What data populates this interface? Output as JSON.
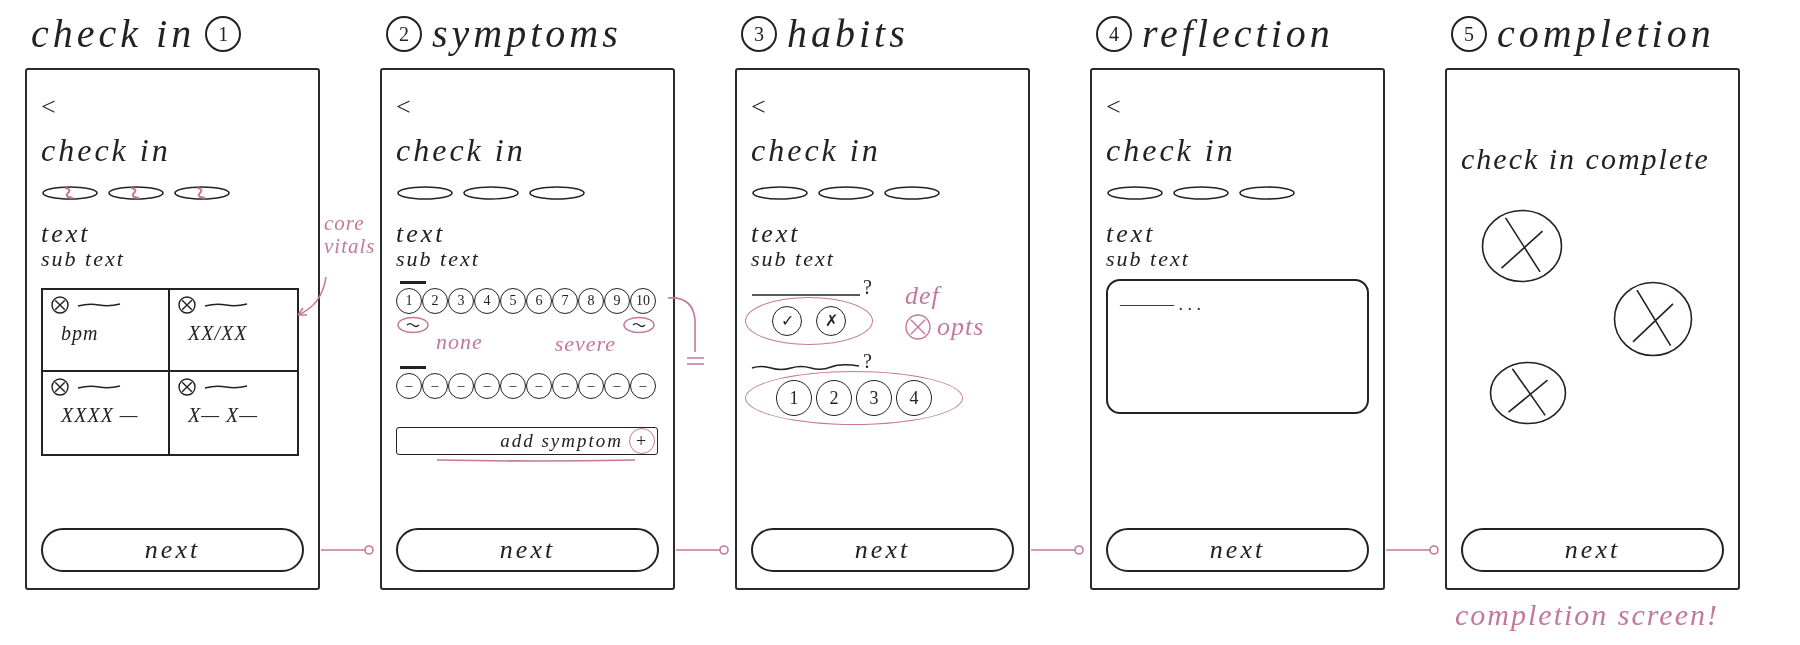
{
  "screens": [
    {
      "kind": "vitals",
      "step": "1",
      "step_after": true,
      "heading": "check in",
      "back": "<",
      "title": "check in",
      "pills": [
        {
          "marked": true
        },
        {
          "marked": true
        },
        {
          "marked": true
        }
      ],
      "text": "text",
      "subtext": "sub text",
      "vitals": [
        {
          "value": "bpm"
        },
        {
          "value": "XX/XX"
        },
        {
          "value": "XXXX —"
        },
        {
          "value": "X— X—"
        }
      ],
      "next": "next",
      "note": "core vitals"
    },
    {
      "kind": "symptoms",
      "step": "2",
      "step_after": false,
      "heading": "symptoms",
      "back": "<",
      "title": "check in",
      "pills": [
        {
          "marked": false
        },
        {
          "marked": false
        },
        {
          "marked": false
        }
      ],
      "text": "text",
      "subtext": "sub text",
      "scales": [
        {
          "options": [
            "1",
            "2",
            "3",
            "4",
            "5",
            "6",
            "7",
            "8",
            "9",
            "10"
          ],
          "low": "none",
          "high": "severe"
        },
        {
          "options": [
            "–",
            "–",
            "–",
            "–",
            "–",
            "–",
            "–",
            "–",
            "–",
            "–"
          ]
        }
      ],
      "add_button": "add symptom",
      "add_sign": "+",
      "next": "next"
    },
    {
      "kind": "habits",
      "step": "3",
      "step_after": false,
      "heading": "habits",
      "back": "<",
      "title": "check in",
      "pills": [
        {
          "marked": false
        },
        {
          "marked": false
        },
        {
          "marked": false
        }
      ],
      "text": "text",
      "subtext": "sub text",
      "questions": [
        {
          "kind": "yesno",
          "mark": "?",
          "options": [
            "✓",
            "✗"
          ]
        },
        {
          "kind": "scale",
          "mark": "?",
          "options": [
            "1",
            "2",
            "3",
            "4"
          ]
        }
      ],
      "notes": [
        {
          "text": "def",
          "icon": false
        },
        {
          "text": "opts",
          "icon": true
        }
      ],
      "next": "next"
    },
    {
      "kind": "reflection",
      "step": "4",
      "step_after": false,
      "heading": "reflection",
      "back": "<",
      "title": "check in",
      "pills": [
        {
          "marked": false
        },
        {
          "marked": false
        },
        {
          "marked": false
        }
      ],
      "text": "text",
      "subtext": "sub text",
      "placeholder": "——— . . .",
      "next": "next"
    },
    {
      "kind": "completion",
      "step": "5",
      "step_after": false,
      "heading": "completion",
      "title": "check in complete",
      "next": "next",
      "note": "completion screen!"
    }
  ]
}
